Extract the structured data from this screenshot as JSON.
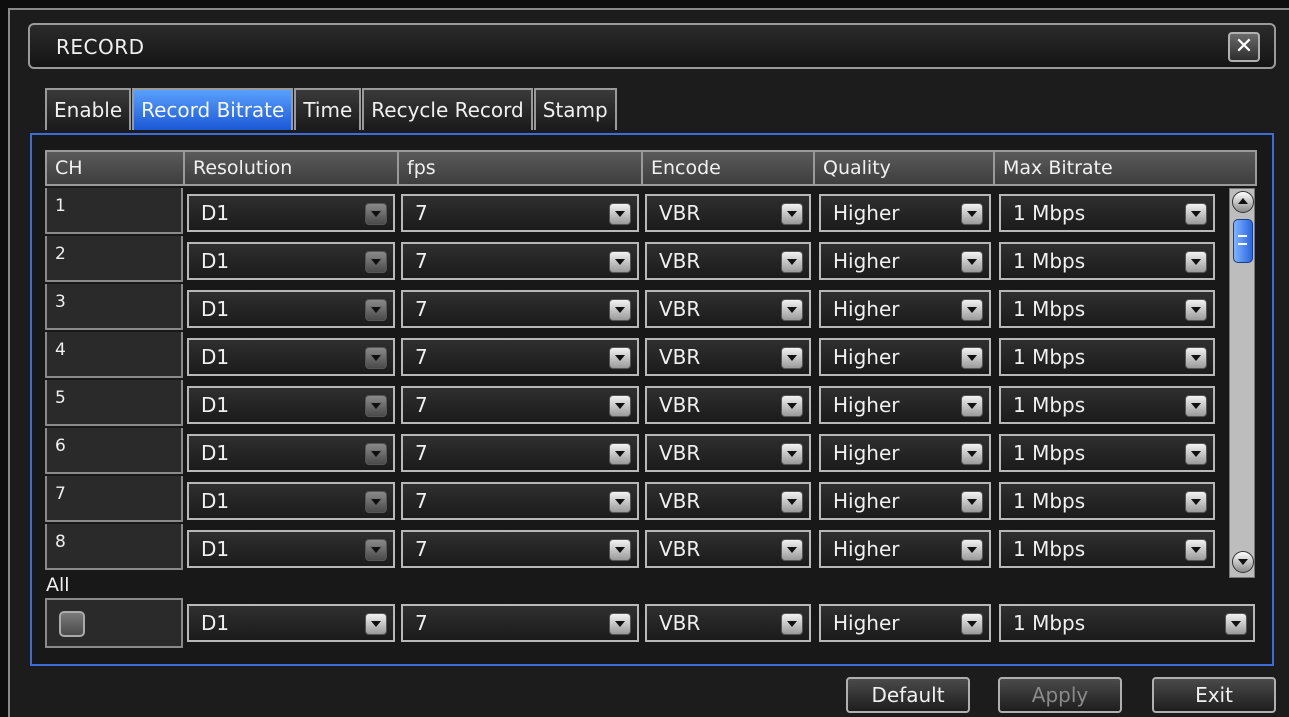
{
  "window": {
    "title": "RECORD",
    "close_symbol": "✕"
  },
  "tabs": [
    {
      "label": "Enable",
      "active": false
    },
    {
      "label": "Record Bitrate",
      "active": true
    },
    {
      "label": "Time",
      "active": false
    },
    {
      "label": "Recycle Record",
      "active": false
    },
    {
      "label": "Stamp",
      "active": false
    }
  ],
  "table": {
    "headers": [
      "CH",
      "Resolution",
      "fps",
      "Encode",
      "Quality",
      "Max Bitrate"
    ],
    "rows": [
      {
        "ch": "1",
        "resolution": "D1",
        "fps": "7",
        "encode": "VBR",
        "quality": "Higher",
        "max_bitrate": "1 Mbps"
      },
      {
        "ch": "2",
        "resolution": "D1",
        "fps": "7",
        "encode": "VBR",
        "quality": "Higher",
        "max_bitrate": "1 Mbps"
      },
      {
        "ch": "3",
        "resolution": "D1",
        "fps": "7",
        "encode": "VBR",
        "quality": "Higher",
        "max_bitrate": "1 Mbps"
      },
      {
        "ch": "4",
        "resolution": "D1",
        "fps": "7",
        "encode": "VBR",
        "quality": "Higher",
        "max_bitrate": "1 Mbps"
      },
      {
        "ch": "5",
        "resolution": "D1",
        "fps": "7",
        "encode": "VBR",
        "quality": "Higher",
        "max_bitrate": "1 Mbps"
      },
      {
        "ch": "6",
        "resolution": "D1",
        "fps": "7",
        "encode": "VBR",
        "quality": "Higher",
        "max_bitrate": "1 Mbps"
      },
      {
        "ch": "7",
        "resolution": "D1",
        "fps": "7",
        "encode": "VBR",
        "quality": "Higher",
        "max_bitrate": "1 Mbps"
      },
      {
        "ch": "8",
        "resolution": "D1",
        "fps": "7",
        "encode": "VBR",
        "quality": "Higher",
        "max_bitrate": "1 Mbps"
      }
    ]
  },
  "all": {
    "label": "All",
    "checked": false,
    "resolution": "D1",
    "fps": "7",
    "encode": "VBR",
    "quality": "Higher",
    "max_bitrate": "1 Mbps"
  },
  "footer": {
    "default_label": "Default",
    "apply_label": "Apply",
    "exit_label": "Exit"
  },
  "colors": {
    "accent": "#3d6cd8",
    "active_tab": "#2a66e0"
  }
}
